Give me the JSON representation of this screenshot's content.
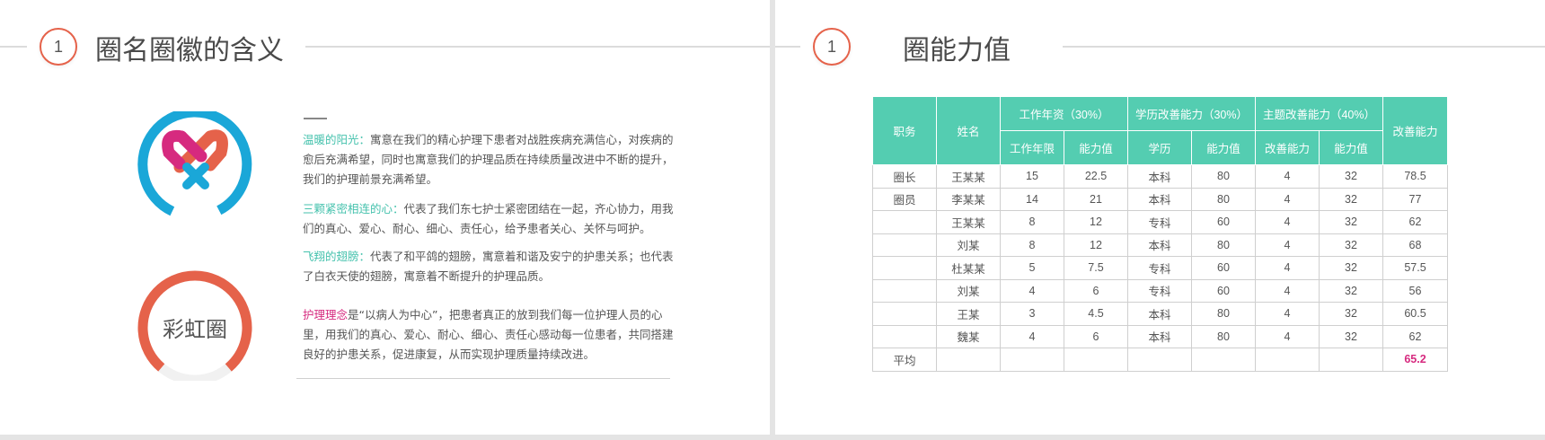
{
  "left_slide": {
    "number": "1",
    "title": "圈名圈徽的含义",
    "paragraphs": [
      {
        "label": "温暖的阳光：",
        "text": "寓意在我们的精心护理下患者对战胜疾病充满信心，对疾病的愈后充满希望，同时也寓意我们的护理品质在持续质量改进中不断的提升，我们的护理前景充满希望。"
      },
      {
        "label": "三颗紧密相连的心：",
        "text": "代表了我们东七护士紧密团结在一起，齐心协力，用我们的真心、爱心、耐心、细心、责任心，给予患者关心、关怀与呵护。"
      },
      {
        "label": "飞翔的翅膀：",
        "text": "代表了和平鸽的翅膀，寓意着和谐及安宁的护患关系；也代表了白衣天使的翅膀，寓意着不断提升的护理品质。"
      },
      {
        "label": "护理理念",
        "text": "是“以病人为中心”，把患者真正的放到我们每一位护理人员的心里，用我们的真心、爱心、耐心、细心、责任心感动每一位患者，共同搭建良好的护患关系，促进康复，从而实现护理质量持续改进。"
      }
    ],
    "circle_label": "彩虹圈",
    "colors": {
      "accent_red": "#e5624a",
      "teal": "#45c2ad",
      "pink": "#d62a7f",
      "blue": "#1aa7d8"
    }
  },
  "right_slide": {
    "number": "1",
    "title": "圈能力值",
    "table": {
      "headers": {
        "duty": "职务",
        "name": "姓名",
        "group1": "工作年资（30%）",
        "group2": "学历改善能力（30%）",
        "group3": "主题改善能力（40%）",
        "improve": "改善能力",
        "years": "工作年限",
        "ability1": "能力值",
        "education": "学历",
        "ability2": "能力值",
        "improve_ability": "改善能力",
        "ability3": "能力值"
      },
      "rows": [
        [
          "圈长",
          "王某某",
          "15",
          "22.5",
          "本科",
          "80",
          "4",
          "32",
          "78.5"
        ],
        [
          "圈员",
          "李某某",
          "14",
          "21",
          "本科",
          "80",
          "4",
          "32",
          "77"
        ],
        [
          "",
          "王某某",
          "8",
          "12",
          "专科",
          "60",
          "4",
          "32",
          "62"
        ],
        [
          "",
          "刘某",
          "8",
          "12",
          "本科",
          "80",
          "4",
          "32",
          "68"
        ],
        [
          "",
          "杜某某",
          "5",
          "7.5",
          "专科",
          "60",
          "4",
          "32",
          "57.5"
        ],
        [
          "",
          "刘某",
          "4",
          "6",
          "专科",
          "60",
          "4",
          "32",
          "56"
        ],
        [
          "",
          "王某",
          "3",
          "4.5",
          "本科",
          "80",
          "4",
          "32",
          "60.5"
        ],
        [
          "",
          "魏某",
          "4",
          "6",
          "本科",
          "80",
          "4",
          "32",
          "62"
        ]
      ],
      "average_label": "平均",
      "average_value": "65.2",
      "header_color": "#54cdb1"
    }
  }
}
